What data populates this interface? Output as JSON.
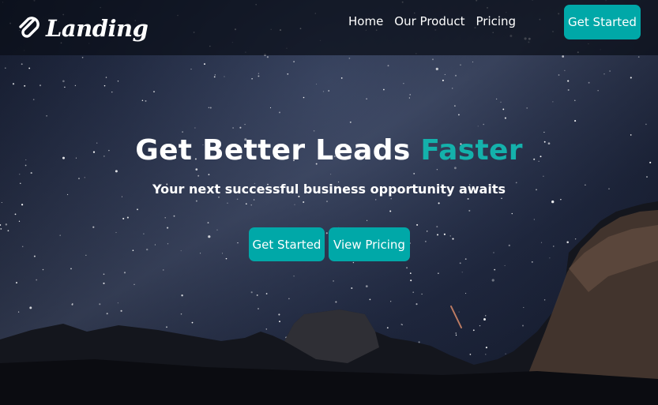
{
  "navbar": {
    "brand_name": "Landing",
    "brand_icon": "paperclip-icon",
    "links": [
      {
        "label": "Home"
      },
      {
        "label": "Our Product"
      },
      {
        "label": "Pricing"
      }
    ],
    "cta_label": "Get Started"
  },
  "hero": {
    "title_main": "Get Better Leads ",
    "title_accent": "Faster",
    "subtitle": "Your next successful business opportunity awaits",
    "primary_button": "Get Started",
    "secondary_button": "View Pricing"
  },
  "colors": {
    "accent": "#00a8a8",
    "navbar_bg": "#0a0e18",
    "text": "#ffffff"
  }
}
